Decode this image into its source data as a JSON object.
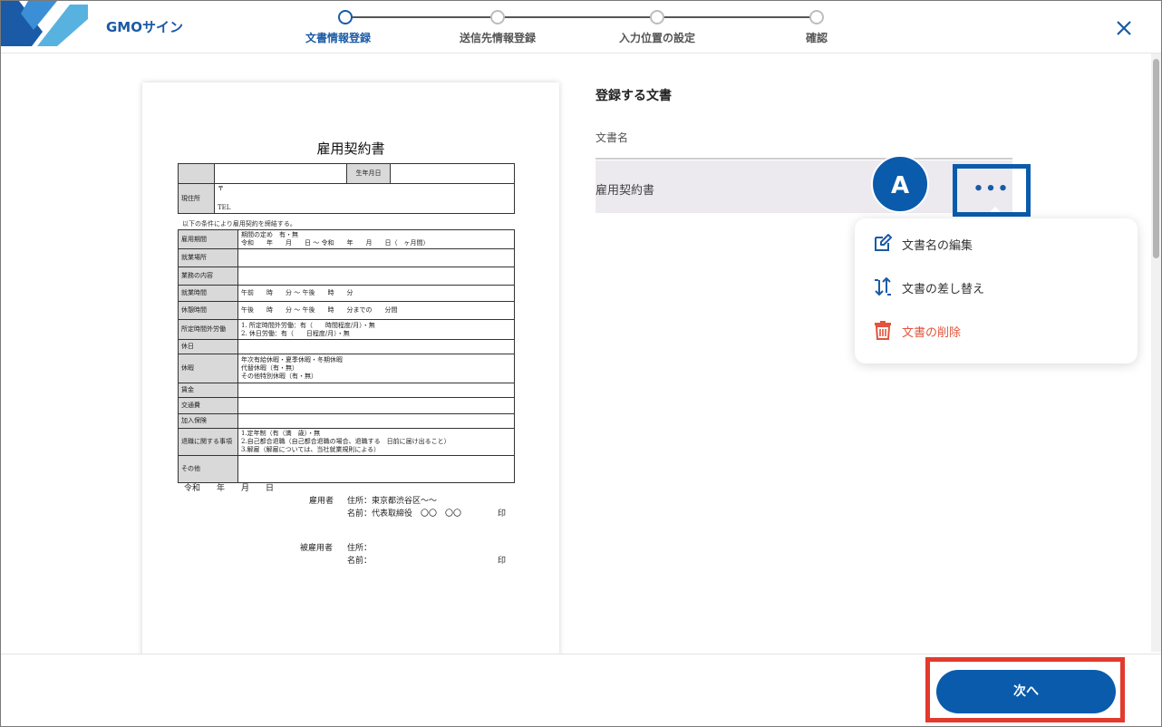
{
  "header": {
    "logo_text": "GMOサイン",
    "steps": [
      {
        "label": "文書情報登録",
        "active": true
      },
      {
        "label": "送信先情報登録",
        "active": false
      },
      {
        "label": "入力位置の設定",
        "active": false
      },
      {
        "label": "確認",
        "active": false
      }
    ],
    "close_icon": "close-icon"
  },
  "document_preview": {
    "title": "雇用契約書",
    "top_rows": {
      "birth_label": "生年月日",
      "address_label": "現住所",
      "postal_mark": "〒",
      "tel_label": "TEL"
    },
    "note": "以下の条件により雇用契約を締結する。",
    "rows": [
      {
        "label": "雇用期間",
        "value": "期間の定め　有・無\n令和　　年　　月　　日 〜 令和　　年　　月　　日（　ヶ月間）"
      },
      {
        "label": "就業場所",
        "value": ""
      },
      {
        "label": "業務の内容",
        "value": ""
      },
      {
        "label": "就業時間",
        "value": "午前　　時　　分 〜 午後　　時　　分"
      },
      {
        "label": "休憩時間",
        "value": "午後　　時　　分 〜 午後　　時　　分までの　　分間"
      },
      {
        "label": "所定時間外労働",
        "value": "1. 所定時間外労働：有（　　時間程度/月）・無\n2. 休日労働：有（　　日程度/月）・無"
      },
      {
        "label": "休日",
        "value": ""
      },
      {
        "label": "休暇",
        "value": "年次有給休暇・夏季休暇・冬期休暇\n代替休暇（有・無）\nその他特別休暇（有・無）"
      },
      {
        "label": "賃金",
        "value": ""
      },
      {
        "label": "交通費",
        "value": ""
      },
      {
        "label": "加入保険",
        "value": ""
      },
      {
        "label": "退職に関する事項",
        "value": "1.定年制（有（満　歳）・無\n2.自己都合退職（自己都合退職の場合、退職する　日前に届け出ること）\n3.解雇（解雇については、当社就業規則による）"
      },
      {
        "label": "その他",
        "value": ""
      }
    ],
    "footer": {
      "date": "令和　　年　　月　　日",
      "employer_label": "雇用者",
      "employer_address": "住所：東京都渋谷区〜〜",
      "employer_name": "名前：代表取締役　〇〇　〇〇",
      "seal1": "印",
      "employee_label": "被雇用者",
      "employee_address": "住所：",
      "employee_name": "名前：",
      "seal2": "印"
    }
  },
  "panel": {
    "section_title": "登録する文書",
    "column_header": "文書名",
    "document_name": "雇用契約書",
    "annotation_badge": "A",
    "more_button": "•••"
  },
  "menu": {
    "items": [
      {
        "label": "文書名の編集",
        "icon": "edit-icon",
        "color": "#1a5aa6"
      },
      {
        "label": "文書の差し替え",
        "icon": "swap-icon",
        "color": "#1a5aa6"
      },
      {
        "label": "文書の削除",
        "icon": "trash-icon",
        "color": "#e2543d"
      }
    ]
  },
  "footer": {
    "next_label": "次へ"
  },
  "colors": {
    "primary": "#0a5bac",
    "danger": "#e2543d",
    "highlight": "#e23a2c"
  }
}
